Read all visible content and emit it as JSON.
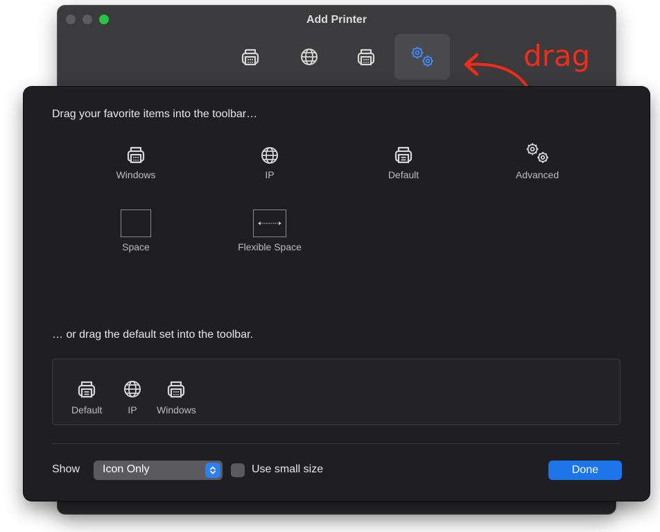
{
  "window": {
    "title": "Add Printer"
  },
  "toolbar": {
    "items": [
      {
        "icon": "printer-windows-icon"
      },
      {
        "icon": "globe-icon"
      },
      {
        "icon": "printer-windows-icon"
      },
      {
        "icon": "gears-icon",
        "active": true
      }
    ]
  },
  "sheet": {
    "heading_items": "Drag your favorite items into the toolbar…",
    "palette": [
      {
        "label": "Windows",
        "icon": "printer-windows-icon"
      },
      {
        "label": "IP",
        "icon": "globe-icon"
      },
      {
        "label": "Default",
        "icon": "printer-default-icon"
      },
      {
        "label": "Advanced",
        "icon": "gears-icon"
      },
      {
        "label": "Space",
        "icon": "space-icon"
      },
      {
        "label": "Flexible Space",
        "icon": "flexible-space-icon"
      }
    ],
    "heading_default_set": "… or drag the default set into the toolbar.",
    "default_set": [
      {
        "label": "Default",
        "icon": "printer-default-icon"
      },
      {
        "label": "IP",
        "icon": "globe-icon"
      },
      {
        "label": "Windows",
        "icon": "printer-windows-icon"
      }
    ],
    "show_label": "Show",
    "show_value": "Icon Only",
    "small_size_label": "Use small size",
    "small_size_checked": false,
    "done_label": "Done"
  },
  "annotation": {
    "text": "drag",
    "color": "#f22c18"
  },
  "colors": {
    "accent": "#1c76e9",
    "close_disabled": "#5d5d60",
    "zoom": "#29c244"
  }
}
